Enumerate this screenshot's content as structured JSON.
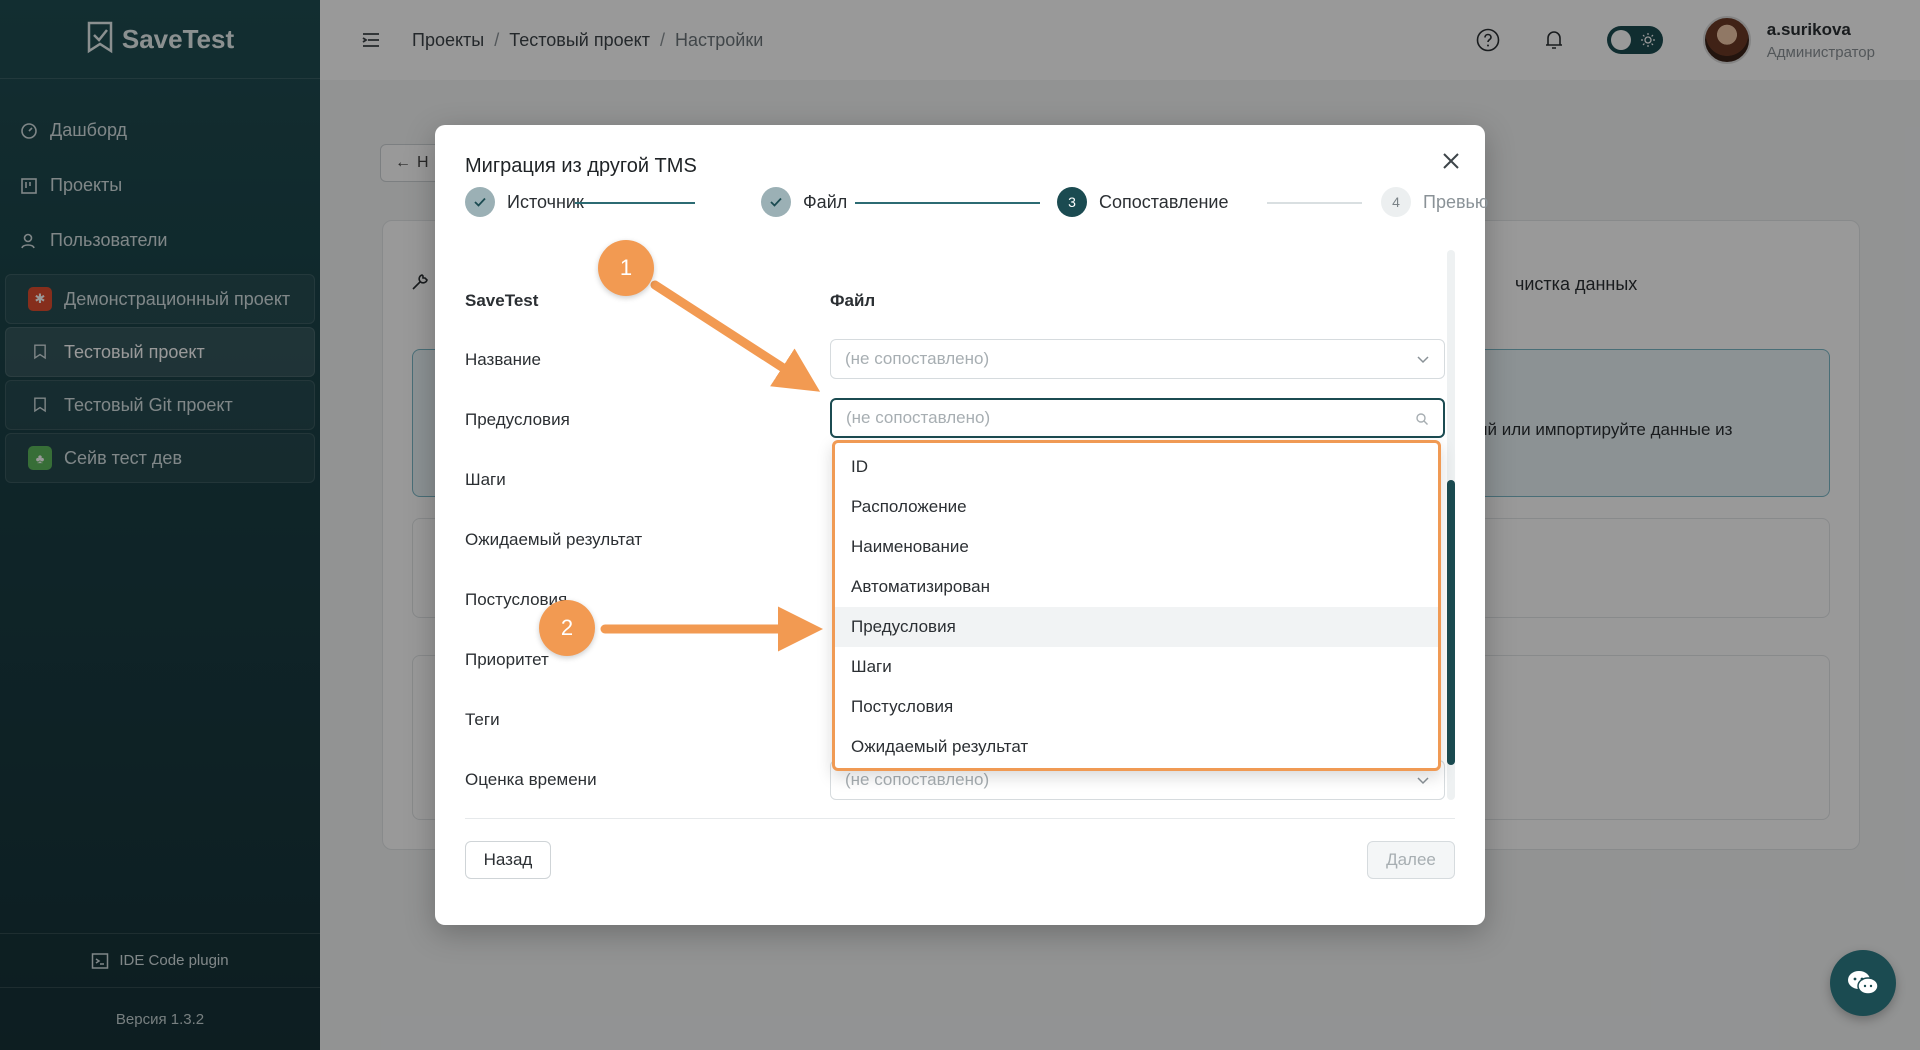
{
  "app": {
    "name": "SaveTest",
    "version": "Версия 1.3.2",
    "ide_plugin": "IDE Code plugin"
  },
  "nav": {
    "items": [
      {
        "label": "Дашборд",
        "icon": "dashboard-icon"
      },
      {
        "label": "Проекты",
        "icon": "projects-icon"
      },
      {
        "label": "Пользователи",
        "icon": "users-icon"
      }
    ],
    "projects": [
      {
        "label": "Демонстрационный проект",
        "color": "#e04e2f",
        "active": false
      },
      {
        "label": "Тестовый проект",
        "color": "#5b6b70",
        "active": true
      },
      {
        "label": "Тестовый Git проект",
        "color": "#5b6b70",
        "active": false
      },
      {
        "label": "Сейв тест дев",
        "color": "#5cb85c",
        "active": false
      }
    ]
  },
  "header": {
    "breadcrumb": [
      "Проекты",
      "Тестовый проект",
      "Настройки"
    ],
    "user": {
      "name": "a.surikova",
      "role": "Администратор"
    }
  },
  "background": {
    "back_label": "Н",
    "tab_fragment": "чистка данных",
    "info_fragment": "ий или импортируйте данные из"
  },
  "modal": {
    "title": "Миграция из другой TMS",
    "steps": [
      {
        "label": "Источник",
        "state": "done",
        "num": ""
      },
      {
        "label": "Файл",
        "state": "done",
        "num": ""
      },
      {
        "label": "Сопоставление",
        "state": "active",
        "num": "3"
      },
      {
        "label": "Превью",
        "state": "todo",
        "num": "4"
      }
    ],
    "col_savetest": "SaveTest",
    "col_file": "Файл",
    "fields": [
      {
        "label": "Название",
        "value": "(не сопоставлено)"
      },
      {
        "label": "Предусловия",
        "value": "(не сопоставлено)"
      },
      {
        "label": "Шаги",
        "value": ""
      },
      {
        "label": "Ожидаемый результат",
        "value": ""
      },
      {
        "label": "Постусловия",
        "value": ""
      },
      {
        "label": "Приоритет",
        "value": ""
      },
      {
        "label": "Теги",
        "value": ""
      },
      {
        "label": "Оценка времени",
        "value": "(не сопоставлено)"
      }
    ],
    "dropdown_options": [
      "ID",
      "Расположение",
      "Наименование",
      "Автоматизирован",
      "Предусловия",
      "Шаги",
      "Постусловия",
      "Ожидаемый результат"
    ],
    "hovered_option": "Предусловия",
    "back_button": "Назад",
    "next_button": "Далее"
  },
  "annotations": {
    "marker1": "1",
    "marker2": "2"
  },
  "colors": {
    "brand": "#1b4b51",
    "annotation": "#f29a52"
  }
}
